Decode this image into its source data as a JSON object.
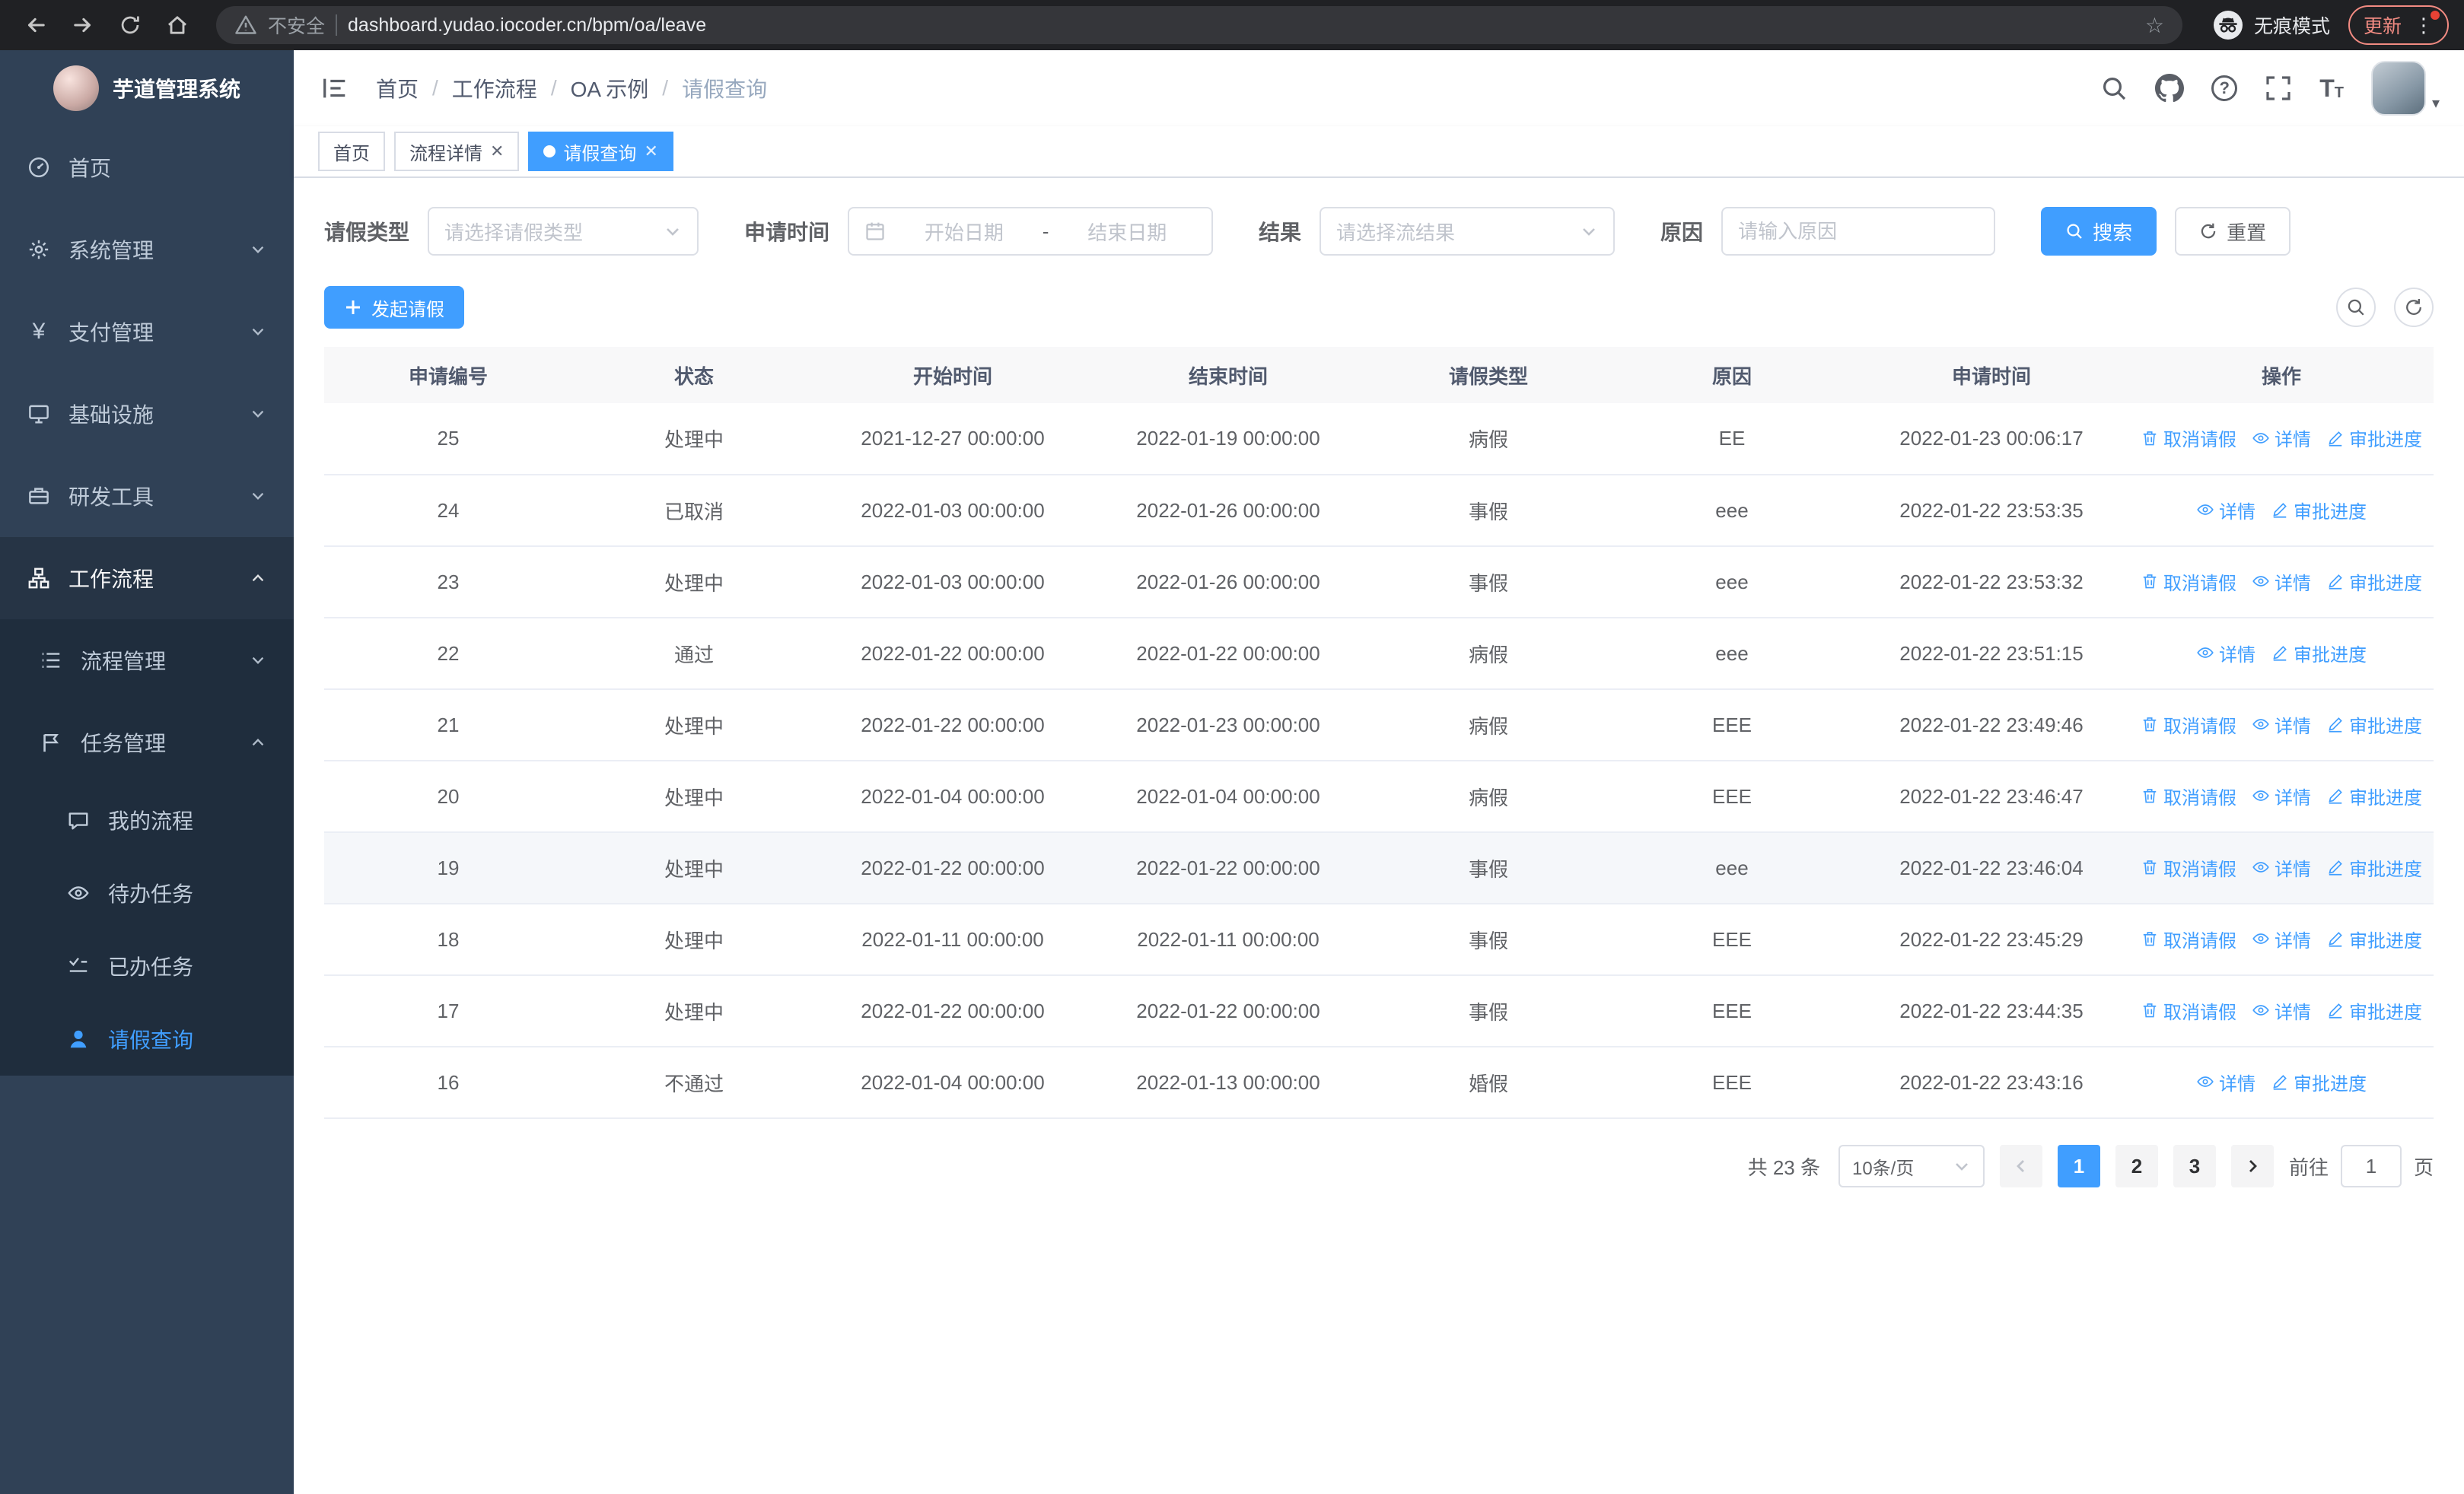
{
  "browser": {
    "security_label": "不安全",
    "url": "dashboard.yudao.iocoder.cn/bpm/oa/leave",
    "incognito_label": "无痕模式",
    "update_label": "更新"
  },
  "icons": {
    "navbar_right": [
      "search-icon",
      "github-icon",
      "help-icon",
      "fullscreen-icon",
      "font-size-icon"
    ],
    "search": "magnifier",
    "refresh": "circular-arrow",
    "calendar": "calendar",
    "delete": "trash",
    "view": "eye",
    "edit": "pen",
    "plus": "+"
  },
  "sidebar": {
    "logo_title": "芋道管理系统",
    "items": [
      {
        "label": "首页"
      },
      {
        "label": "系统管理"
      },
      {
        "label": "支付管理"
      },
      {
        "label": "基础设施"
      },
      {
        "label": "研发工具"
      },
      {
        "label": "工作流程"
      }
    ],
    "workflow_children": [
      {
        "label": "流程管理"
      },
      {
        "label": "任务管理"
      }
    ],
    "task_children": [
      {
        "label": "我的流程"
      },
      {
        "label": "待办任务"
      },
      {
        "label": "已办任务"
      },
      {
        "label": "请假查询"
      }
    ]
  },
  "header": {
    "breadcrumb": [
      "首页",
      "工作流程",
      "OA 示例",
      "请假查询"
    ]
  },
  "tabs": [
    {
      "label": "首页"
    },
    {
      "label": "流程详情"
    },
    {
      "label": "请假查询"
    }
  ],
  "filters": {
    "leave_type_label": "请假类型",
    "leave_type_placeholder": "请选择请假类型",
    "apply_time_label": "申请时间",
    "start_date_placeholder": "开始日期",
    "range_separator": "-",
    "end_date_placeholder": "结束日期",
    "result_label": "结果",
    "result_placeholder": "请选择流结果",
    "reason_label": "原因",
    "reason_placeholder": "请输入原因",
    "search_button": "搜索",
    "reset_button": "重置"
  },
  "toolbar": {
    "create_button": "发起请假"
  },
  "table": {
    "columns": [
      "申请编号",
      "状态",
      "开始时间",
      "结束时间",
      "请假类型",
      "原因",
      "申请时间",
      "操作"
    ],
    "action_cancel": "取消请假",
    "action_detail": "详情",
    "action_progress": "审批进度",
    "rows": [
      {
        "id": "25",
        "status": "处理中",
        "start": "2021-12-27 00:00:00",
        "end": "2022-01-19 00:00:00",
        "type": "病假",
        "reason": "EE",
        "applied": "2022-01-23 00:06:17",
        "cancelable": true,
        "hover": false
      },
      {
        "id": "24",
        "status": "已取消",
        "start": "2022-01-03 00:00:00",
        "end": "2022-01-26 00:00:00",
        "type": "事假",
        "reason": "eee",
        "applied": "2022-01-22 23:53:35",
        "cancelable": false,
        "hover": false
      },
      {
        "id": "23",
        "status": "处理中",
        "start": "2022-01-03 00:00:00",
        "end": "2022-01-26 00:00:00",
        "type": "事假",
        "reason": "eee",
        "applied": "2022-01-22 23:53:32",
        "cancelable": true,
        "hover": false
      },
      {
        "id": "22",
        "status": "通过",
        "start": "2022-01-22 00:00:00",
        "end": "2022-01-22 00:00:00",
        "type": "病假",
        "reason": "eee",
        "applied": "2022-01-22 23:51:15",
        "cancelable": false,
        "hover": false
      },
      {
        "id": "21",
        "status": "处理中",
        "start": "2022-01-22 00:00:00",
        "end": "2022-01-23 00:00:00",
        "type": "病假",
        "reason": "EEE",
        "applied": "2022-01-22 23:49:46",
        "cancelable": true,
        "hover": false
      },
      {
        "id": "20",
        "status": "处理中",
        "start": "2022-01-04 00:00:00",
        "end": "2022-01-04 00:00:00",
        "type": "病假",
        "reason": "EEE",
        "applied": "2022-01-22 23:46:47",
        "cancelable": true,
        "hover": false
      },
      {
        "id": "19",
        "status": "处理中",
        "start": "2022-01-22 00:00:00",
        "end": "2022-01-22 00:00:00",
        "type": "事假",
        "reason": "eee",
        "applied": "2022-01-22 23:46:04",
        "cancelable": true,
        "hover": true
      },
      {
        "id": "18",
        "status": "处理中",
        "start": "2022-01-11 00:00:00",
        "end": "2022-01-11 00:00:00",
        "type": "事假",
        "reason": "EEE",
        "applied": "2022-01-22 23:45:29",
        "cancelable": true,
        "hover": false
      },
      {
        "id": "17",
        "status": "处理中",
        "start": "2022-01-22 00:00:00",
        "end": "2022-01-22 00:00:00",
        "type": "事假",
        "reason": "EEE",
        "applied": "2022-01-22 23:44:35",
        "cancelable": true,
        "hover": false
      },
      {
        "id": "16",
        "status": "不通过",
        "start": "2022-01-04 00:00:00",
        "end": "2022-01-13 00:00:00",
        "type": "婚假",
        "reason": "EEE",
        "applied": "2022-01-22 23:43:16",
        "cancelable": false,
        "hover": false
      }
    ]
  },
  "pagination": {
    "total_text": "共 23 条",
    "page_size": "10条/页",
    "pages": [
      "1",
      "2",
      "3"
    ],
    "active_page": "1",
    "goto_label": "前往",
    "goto_value": "1",
    "goto_suffix": "页"
  },
  "colors": {
    "accent": "#409eff",
    "sidebar_bg": "#304156",
    "sidebar_sub_bg": "#1f2d3d",
    "table_header_bg": "#f8f8f9"
  }
}
